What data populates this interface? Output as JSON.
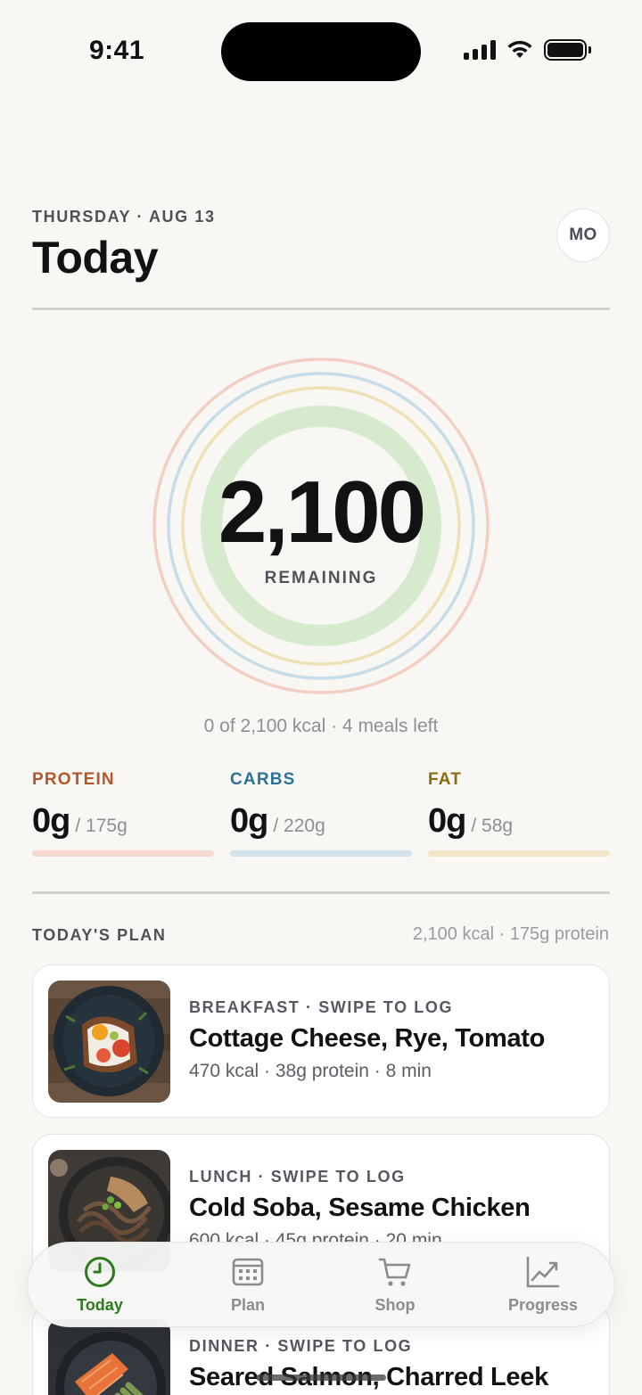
{
  "status": {
    "time": "9:41",
    "signal_icon": "cellular-signal-icon",
    "wifi_icon": "wifi-icon",
    "battery_icon": "battery-icon"
  },
  "header": {
    "date": "THURSDAY · AUG 13",
    "title": "Today",
    "avatar_initials": "MO"
  },
  "calories": {
    "remaining_value": "2,100",
    "remaining_label": "REMAINING",
    "summary": "0 of 2,100 kcal · 4 meals left",
    "consumed_fraction": 0
  },
  "macros": [
    {
      "label": "PROTEIN",
      "current": "0g",
      "target": "/ 175g",
      "fraction": 0,
      "color": "#b5552a",
      "track_color": "#f5d9cf"
    },
    {
      "label": "CARBS",
      "current": "0g",
      "target": "/ 220g",
      "fraction": 0,
      "color": "#2a7396",
      "track_color": "#d3e3eb"
    },
    {
      "label": "FAT",
      "current": "0g",
      "target": "/ 58g",
      "fraction": 0,
      "color": "#8a6a14",
      "track_color": "#f2e5c8"
    }
  ],
  "rings": {
    "colors": [
      "#f3cfc3",
      "#c6dde9",
      "#efe1b6",
      "#d6ebcd"
    ]
  },
  "plan": {
    "title": "TODAY'S PLAN",
    "summary": "2,100 kcal · 175g protein",
    "meals": [
      {
        "meta": "BREAKFAST · SWIPE TO LOG",
        "name": "Cottage Cheese, Rye, Tomato",
        "stats": "470 kcal · 38g protein · 8 min",
        "image": "cottage-cheese-toast-photo"
      },
      {
        "meta": "LUNCH · SWIPE TO LOG",
        "name": "Cold Soba, Sesame Chicken",
        "stats": "600 kcal · 45g protein · 20 min",
        "image": "soba-chicken-photo"
      },
      {
        "meta": "DINNER · SWIPE TO LOG",
        "name": "Seared Salmon, Charred Leek",
        "stats": "",
        "image": "salmon-leek-photo"
      }
    ]
  },
  "tabs": [
    {
      "label": "Today",
      "icon": "clock-icon",
      "active": true
    },
    {
      "label": "Plan",
      "icon": "calendar-icon",
      "active": false
    },
    {
      "label": "Shop",
      "icon": "cart-icon",
      "active": false
    },
    {
      "label": "Progress",
      "icon": "chart-icon",
      "active": false
    }
  ],
  "colors": {
    "accent": "#2d7a1f",
    "background": "#f8f7f3"
  }
}
